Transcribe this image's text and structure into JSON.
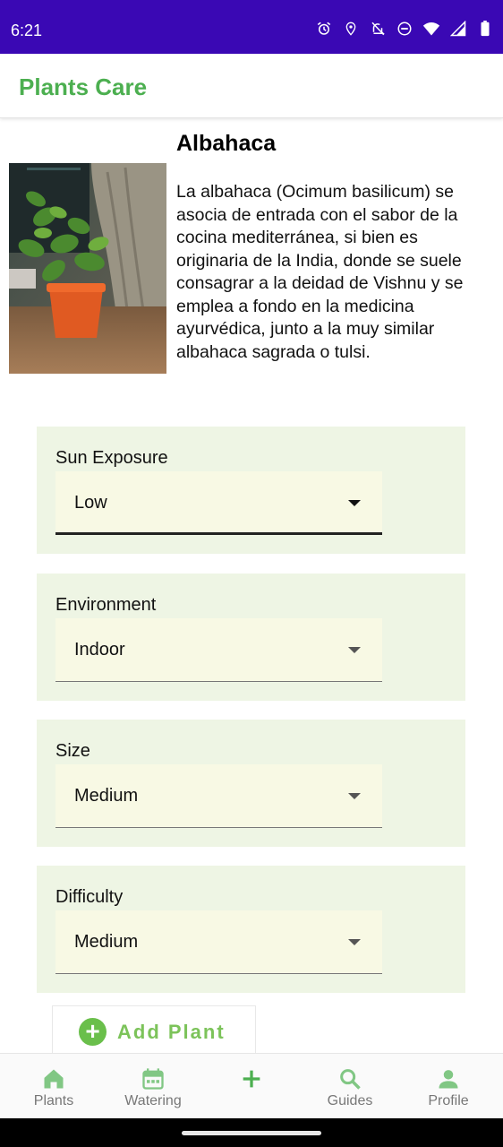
{
  "status_bar": {
    "time": "6:21",
    "icons": [
      "alarm-icon",
      "location-icon",
      "notifications-off-icon",
      "do-not-disturb-icon",
      "wifi-icon",
      "signal-icon",
      "battery-icon"
    ]
  },
  "app_bar": {
    "title": "Plants Care",
    "title_color": "#4caf50"
  },
  "plant": {
    "name": "Albahaca",
    "description": "La albahaca (Ocimum basilicum) se asocia de entrada con el sabor de la cocina mediterránea, si bien es originaria de la India, donde se suele consagrar a la deidad de Vishnu y se emplea a fondo en la medicina ayurvédica, junto a la muy similar albahaca sagrada o tulsi."
  },
  "fields": [
    {
      "label": "Sun Exposure",
      "value": "Low"
    },
    {
      "label": "Environment",
      "value": "Indoor"
    },
    {
      "label": "Size",
      "value": "Medium"
    },
    {
      "label": "Difficulty",
      "value": "Medium"
    }
  ],
  "add_button": {
    "label": "Add Plant",
    "icon": "add-circle-icon"
  },
  "bottom_nav": {
    "items": [
      {
        "label": "Plants",
        "icon": "home-icon"
      },
      {
        "label": "Watering",
        "icon": "calendar-icon"
      },
      {
        "label": "",
        "icon": "add-icon"
      },
      {
        "label": "Guides",
        "icon": "search-icon"
      },
      {
        "label": "Profile",
        "icon": "person-icon"
      }
    ]
  },
  "colors": {
    "status_bar": "#3a08b4",
    "accent_green": "#4caf50",
    "card_bg": "#eef5e4",
    "select_bg": "#f8f9e4",
    "nav_icon": "#81c784"
  }
}
